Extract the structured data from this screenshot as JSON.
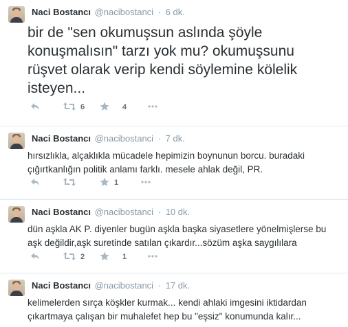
{
  "tweets": [
    {
      "name": "Naci Bostancı",
      "handle": "@nacibostanci",
      "separator": "·",
      "time": "6 dk.",
      "lines": [
        "bir de \"sen okumuşsun aslında şöyle",
        "konuşmalısın\" tarzı yok mu? okumuşsunu",
        "rüşvet olarak verip kendi söylemine kölelik",
        "isteyen..."
      ],
      "retweets": "6",
      "favorites": "4"
    },
    {
      "name": "Naci Bostancı",
      "handle": "@nacibostanci",
      "separator": "·",
      "time": "7 dk.",
      "lines": [
        "hırsızlıkla, alçaklıkla mücadele hepimizin boynunun borcu. buradaki",
        "çığırtkanlığın politik anlamı farklı. mesele ahlak değil, PR."
      ],
      "retweets": "",
      "favorites": "1"
    },
    {
      "name": "Naci Bostancı",
      "handle": "@nacibostanci",
      "separator": "·",
      "time": "10 dk.",
      "lines": [
        "dün aşkla AK P. diyenler bugün aşkla başka siyasetlere yönelmişlerse bu",
        "aşk değildir,aşk suretinde satılan çıkardır...sözüm aşka saygılılara"
      ],
      "retweets": "2",
      "favorites": "1"
    },
    {
      "name": "Naci Bostancı",
      "handle": "@nacibostanci",
      "separator": "·",
      "time": "17 dk.",
      "lines": [
        "kelimelerden sırça köşkler kurmak... kendi ahlaki imgesini iktidardan",
        "çıkartmaya çalışan bir muhalefet hep bu \"eşsiz\" konumunda kalır..."
      ],
      "retweets": "",
      "favorites": ""
    }
  ],
  "icons": {
    "reply": "reply-icon",
    "retweet": "retweet-icon",
    "favorite": "star-icon",
    "more": "more-icon"
  },
  "colors": {
    "name": "#292f33",
    "meta": "#8899a6",
    "action": "#aab8c2",
    "divider": "#e1e8ed"
  }
}
